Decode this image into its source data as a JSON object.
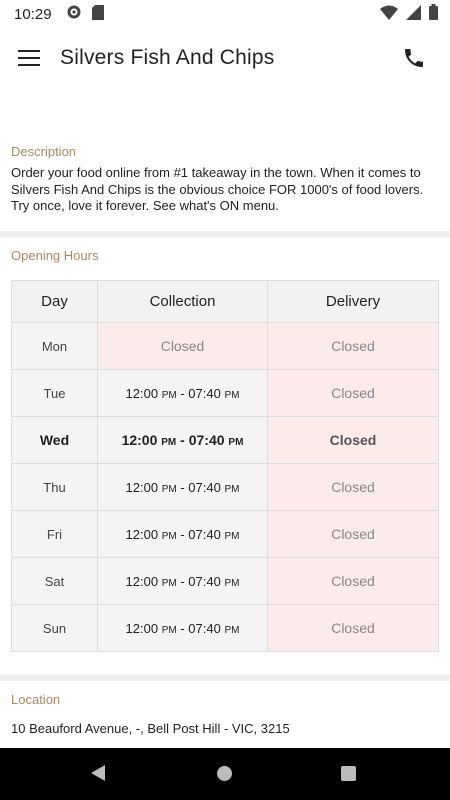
{
  "status_bar": {
    "time": "10:29"
  },
  "app_bar": {
    "title": "Silvers Fish And Chips"
  },
  "description": {
    "label": "Description",
    "text": "Order your food online from #1 takeaway in the town. When it comes to Silvers Fish And Chips is the obvious choice FOR 1000's of food lovers. Try once, love it forever. See what's ON menu."
  },
  "opening_hours": {
    "label": "Opening Hours",
    "headers": {
      "day": "Day",
      "collection": "Collection",
      "delivery": "Delivery"
    },
    "rows": [
      {
        "day": "Mon",
        "collection": "Closed",
        "delivery": "Closed"
      },
      {
        "day": "Tue",
        "collection_start": "12:00",
        "collection_end": "07:40",
        "delivery": "Closed"
      },
      {
        "day": "Wed",
        "collection_start": "12:00",
        "collection_end": "07:40",
        "delivery": "Closed"
      },
      {
        "day": "Thu",
        "collection_start": "12:00",
        "collection_end": "07:40",
        "delivery": "Closed"
      },
      {
        "day": "Fri",
        "collection_start": "12:00",
        "collection_end": "07:40",
        "delivery": "Closed"
      },
      {
        "day": "Sat",
        "collection_start": "12:00",
        "collection_end": "07:40",
        "delivery": "Closed"
      },
      {
        "day": "Sun",
        "collection_start": "12:00",
        "collection_end": "07:40",
        "delivery": "Closed"
      }
    ],
    "pm_label": "PM",
    "separator": " - "
  },
  "location": {
    "label": "Location",
    "address": "10 Beauford Avenue, -, Bell Post Hill - VIC, 3215"
  },
  "colors": {
    "accent_label": "#a98a5e",
    "closed_bg": "#fdebeb"
  }
}
